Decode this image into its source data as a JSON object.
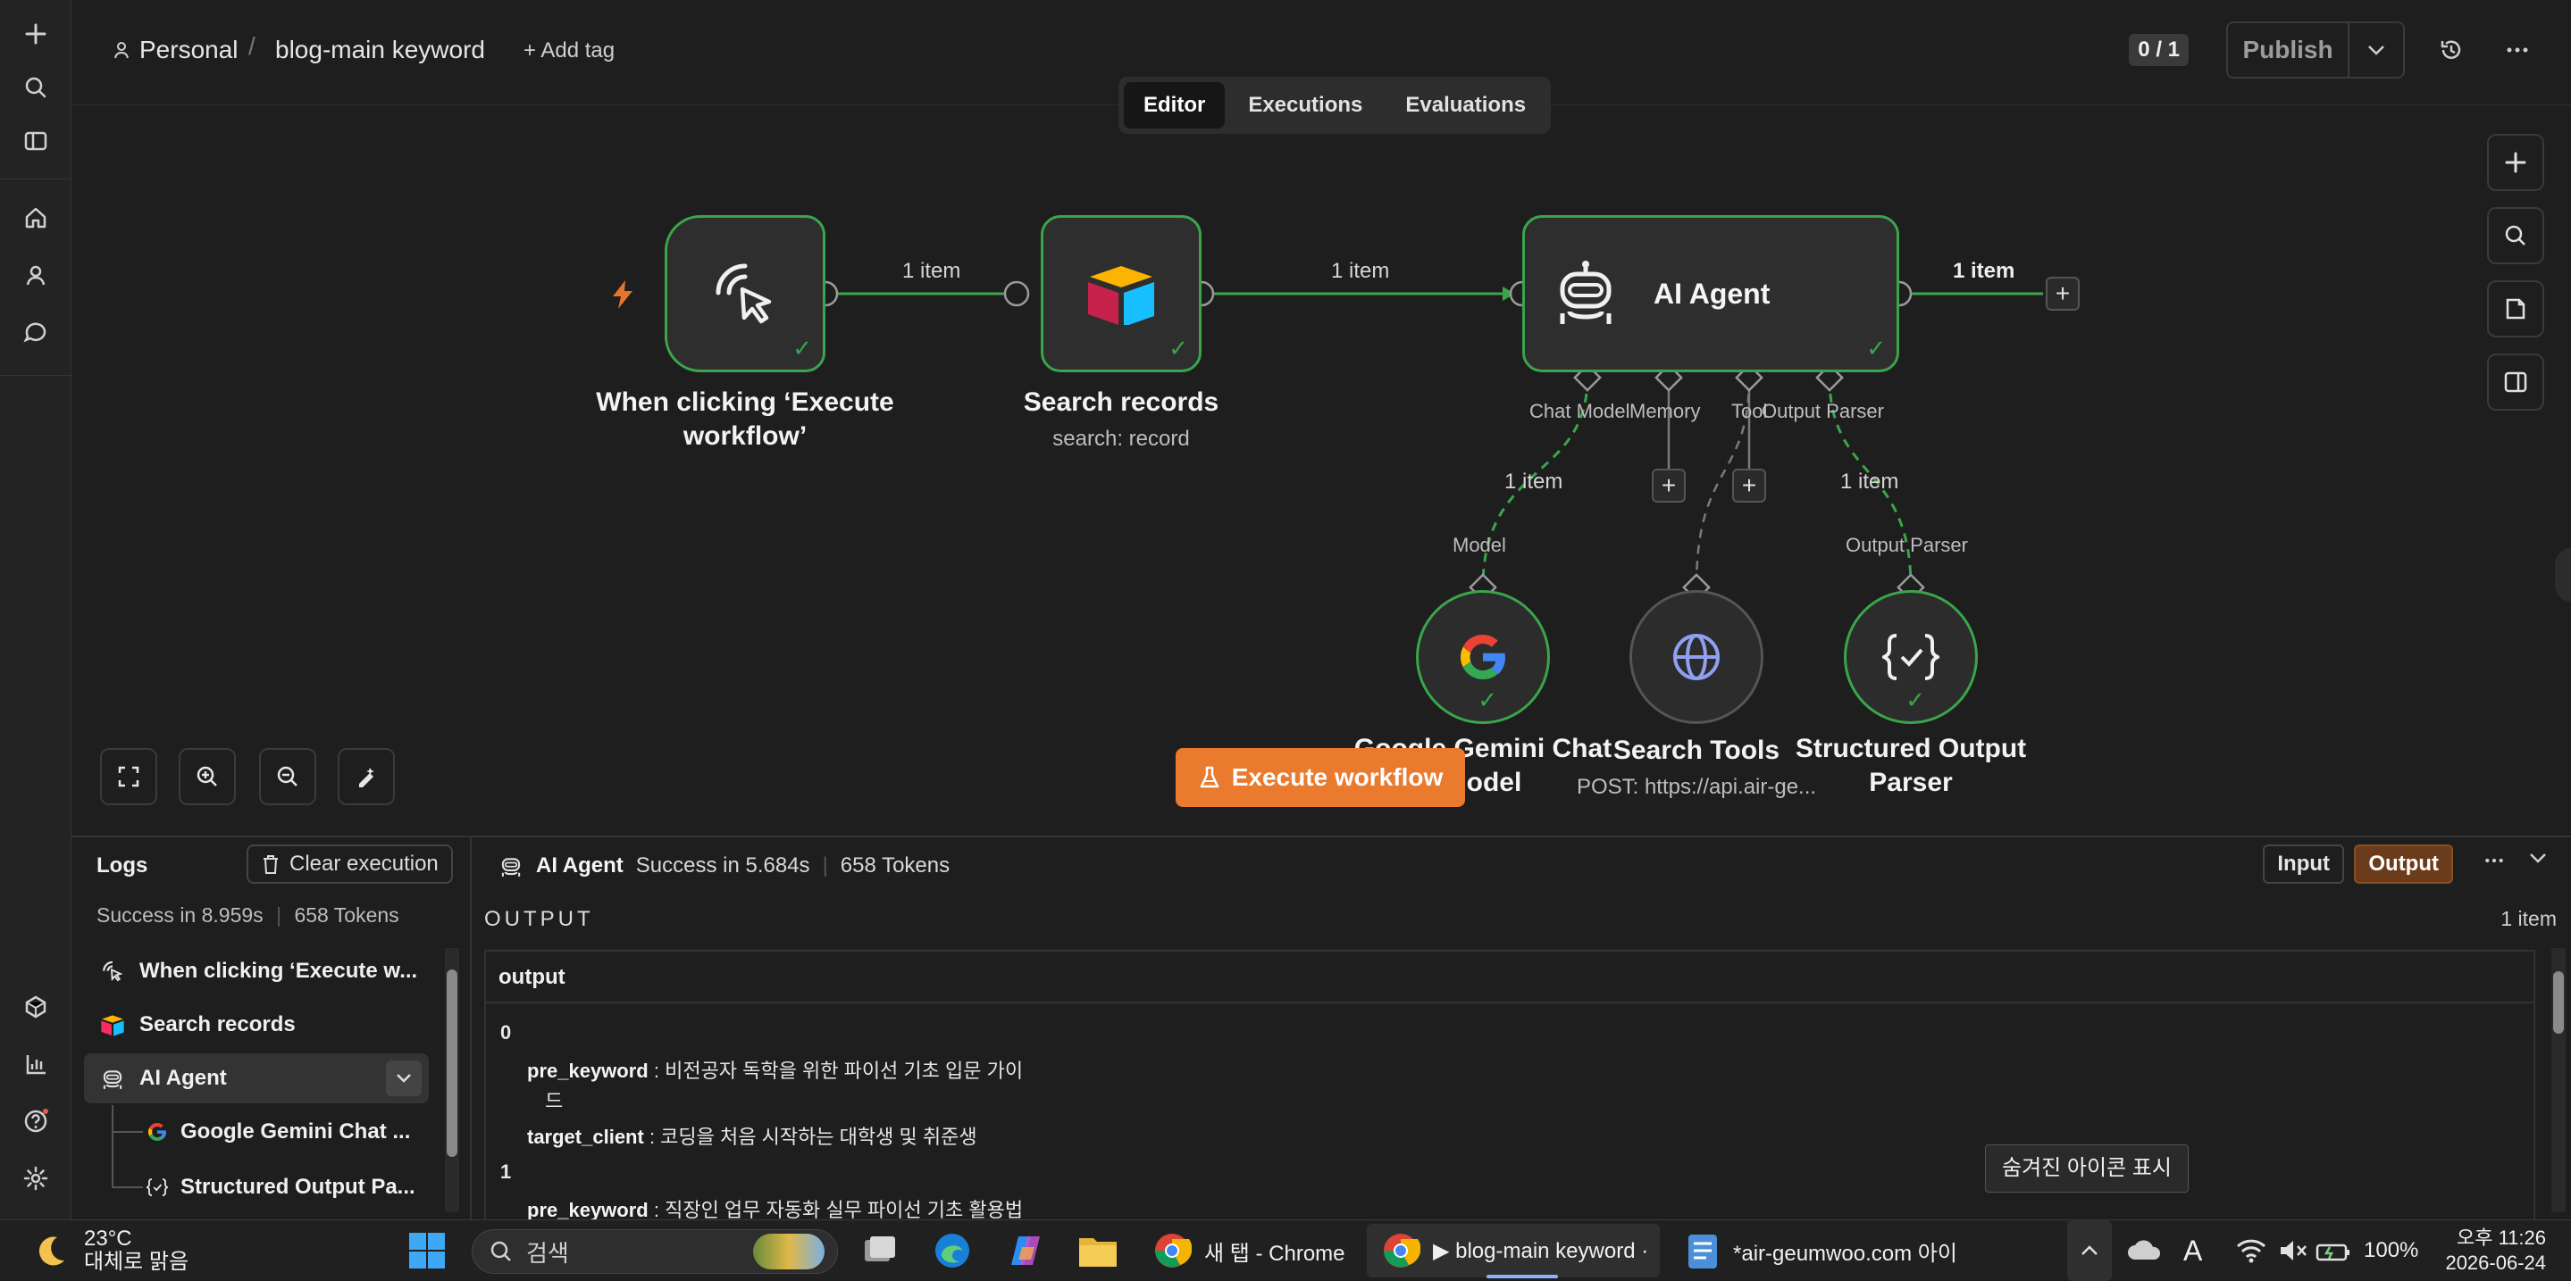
{
  "header": {
    "project": "Personal",
    "workflow_name": "blog-main keyword",
    "add_tag": "+ Add tag",
    "counter": "0 / 1",
    "publish": "Publish"
  },
  "tabs": [
    "Editor",
    "Executions",
    "Evaluations"
  ],
  "canvas": {
    "nodes": {
      "trigger": {
        "title_line1": "When clicking ‘Execute",
        "title_line2": "workflow’"
      },
      "search": {
        "title": "Search records",
        "subtitle": "search: record"
      },
      "agent": {
        "title": "AI Agent"
      },
      "gemini": {
        "title_line1": "Google Gemini Chat",
        "title_line2": "Model"
      },
      "tools": {
        "title": "Search Tools",
        "subtitle": "POST: https://api.air-ge..."
      },
      "parser": {
        "title_line1": "Structured Output",
        "title_line2": "Parser"
      }
    },
    "wire_labels": {
      "w1": "1 item",
      "w2": "1 item",
      "w3": "1 item",
      "w4": "1 item",
      "w5": "1 item"
    },
    "ports": {
      "chat_model": "Chat Model",
      "memory": "Memory",
      "tool": "Tool",
      "output_parser": "Output Parser",
      "model": "Model",
      "parser_in": "Output Parser"
    },
    "execute_button": "Execute workflow"
  },
  "logs": {
    "title": "Logs",
    "clear": "Clear execution",
    "meta_time": "Success in 8.959s",
    "meta_tokens": "658 Tokens",
    "items": [
      "When clicking ‘Execute w...",
      "Search records",
      "AI Agent",
      "Google Gemini Chat ...",
      "Structured Output Pa..."
    ]
  },
  "output": {
    "node": "AI Agent",
    "status": "Success in 5.684s",
    "tokens": "658 Tokens",
    "input_btn": "Input",
    "output_btn": "Output",
    "label": "OUTPUT",
    "count": "1 item",
    "column": "output",
    "rows": [
      {
        "index": "0",
        "pre_key": "pre_keyword",
        "pre_val_1": ": 비전공자 독학을 위한 파이선 기초 입문 가이",
        "pre_val_2": "드",
        "target_key": "target_client",
        "target_val": ": 코딩을 처음 시작하는 대학생 및 취준생"
      },
      {
        "index": "1",
        "pre_key": "pre_keyword",
        "pre_val_1": ": 직장인 업무 자동화 실무 파이선 기초 활용법"
      }
    ]
  },
  "tooltip": "숨겨진 아이콘 표시",
  "taskbar": {
    "weather_temp": "23°C",
    "weather_desc": "대체로 맑음",
    "search": "검색",
    "apps": {
      "chrome1": "새 탭 - Chrome",
      "chrome2": "▶ blog-main keyword ·",
      "notepad": "*air-geumwoo.com 아이"
    },
    "battery": "100%",
    "time": "오후 11:26",
    "date": "2026-06-24"
  },
  "colors": {
    "success_green": "#3aa54a",
    "execute_orange": "#ea7a2e",
    "output_btn": "#6b3c1c"
  }
}
